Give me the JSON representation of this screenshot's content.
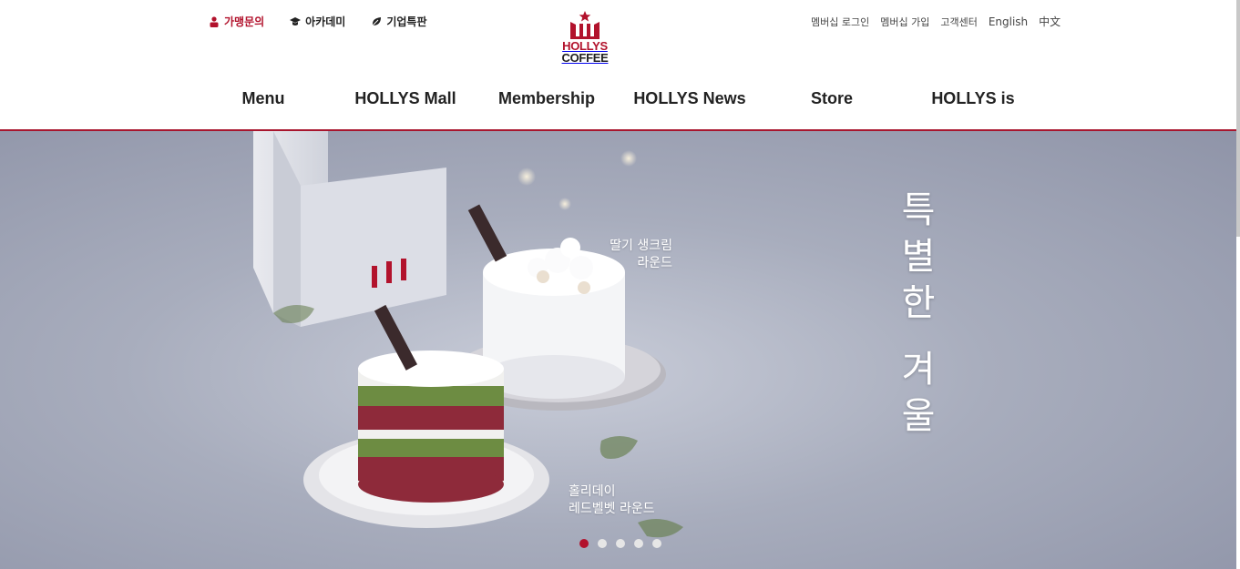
{
  "utility_left": [
    {
      "label": "가맹문의",
      "icon": "person-icon"
    },
    {
      "label": "아카데미",
      "icon": "graduation-cap-icon"
    },
    {
      "label": "기업특판",
      "icon": "leaf-icon"
    }
  ],
  "utility_right": [
    "멤버십 로그인",
    "멤버십 가입",
    "고객센터",
    "English",
    "中文"
  ],
  "logo": {
    "line1": "HOLLYS",
    "line2": "COFFEE"
  },
  "nav": [
    "Menu",
    "HOLLYS Mall",
    "Membership",
    "HOLLYS News",
    "Store",
    "HOLLYS is"
  ],
  "hero": {
    "headline": [
      "특",
      "별",
      "한",
      "",
      "겨",
      "울"
    ],
    "caption_top": [
      "딸기 생크림",
      "라운드"
    ],
    "caption_bottom": [
      "홀리데이",
      "레드벨벳 라운드"
    ],
    "stick_label": "HOLLYS COFFEE",
    "slides": 5,
    "active_slide": 1
  },
  "colors": {
    "brand": "#b2122c",
    "rule": "#a8162e"
  }
}
